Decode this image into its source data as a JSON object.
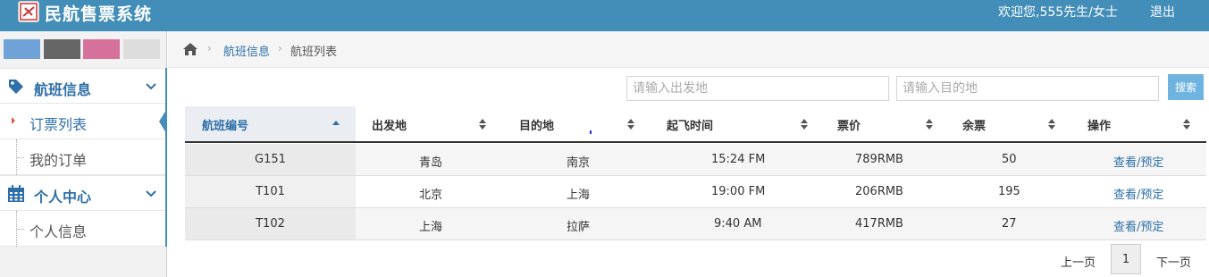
{
  "header": {
    "app_title": "民航售票系统",
    "welcome": "欢迎您,555先生/女士",
    "logout": "退出"
  },
  "colors": {
    "topbar": "#438eb9",
    "link": "#2e6fa8",
    "search_button": "#6fb3e0",
    "swatches": [
      "#6fa3d8",
      "#666666",
      "#d5719b",
      "#dddddd"
    ]
  },
  "sidebar": {
    "groups": [
      {
        "label": "航班信息",
        "icon": "tag-icon",
        "items": [
          {
            "label": "订票列表",
            "active": true
          },
          {
            "label": "我的订单"
          }
        ]
      },
      {
        "label": "个人中心",
        "icon": "calendar-icon",
        "items": [
          {
            "label": "个人信息"
          }
        ]
      }
    ]
  },
  "breadcrumb": {
    "home_icon": "home-icon",
    "section": "航班信息",
    "current": "航班列表"
  },
  "search": {
    "from_placeholder": "请输入出发地",
    "to_placeholder": "请输入目的地",
    "button": "搜索"
  },
  "table": {
    "columns": [
      "航班编号",
      "出发地",
      "目的地",
      "起飞时间",
      "票价",
      "余票",
      "操作"
    ],
    "sorted_column": "航班编号",
    "rows": [
      {
        "flight": "G151",
        "from": "青岛",
        "to": "南京",
        "time": "15:24 FM",
        "price": "789RMB",
        "seats": "50",
        "view": "查看",
        "sep": "/",
        "book": "预定"
      },
      {
        "flight": "T101",
        "from": "北京",
        "to": "上海",
        "time": "19:00 FM",
        "price": "206RMB",
        "seats": "195",
        "view": "查看",
        "sep": "/",
        "book": "预定"
      },
      {
        "flight": "T102",
        "from": "上海",
        "to": "拉萨",
        "time": "9:40 AM",
        "price": "417RMB",
        "seats": "27",
        "view": "查看",
        "sep": "/",
        "book": "预定"
      }
    ]
  },
  "pagination": {
    "prev": "上一页",
    "current_page": "1",
    "next": "下一页"
  }
}
